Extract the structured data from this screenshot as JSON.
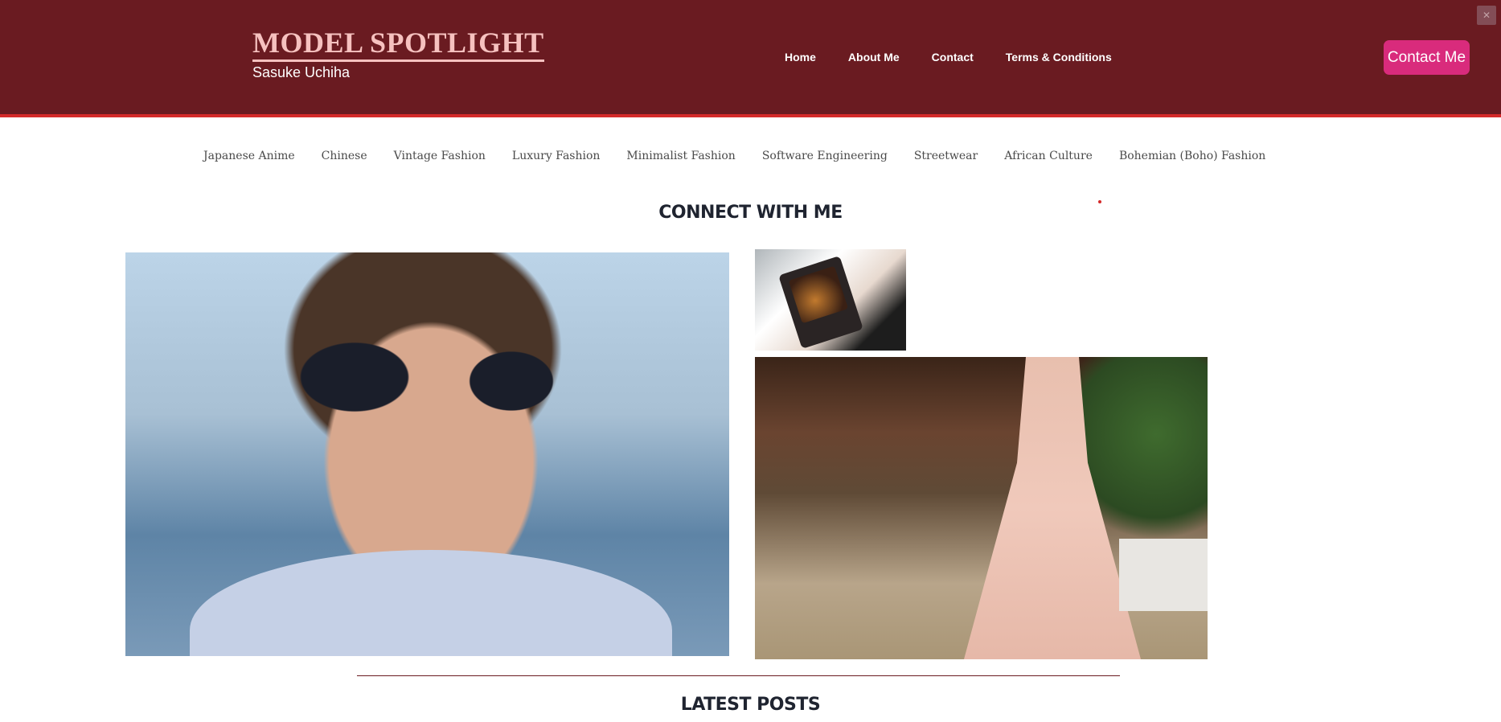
{
  "header": {
    "title": "MODEL SPOTLIGHT",
    "subtitle": "Sasuke Uchiha",
    "nav": [
      "Home",
      "About Me",
      "Contact",
      "Terms & Conditions"
    ],
    "cta_label": "Contact Me"
  },
  "categories": [
    "Japanese Anime",
    "Chinese",
    "Vintage Fashion",
    "Luxury Fashion",
    "Minimalist Fashion",
    "Software Engineering",
    "Streetwear",
    "African Culture",
    "Bohemian (Boho) Fashion"
  ],
  "sections": {
    "connect_title": "CONNECT WITH ME",
    "latest_title": "LATEST POSTS"
  },
  "colors": {
    "header_bg": "#6a1b21",
    "accent_red": "#d42a2a",
    "title_pink": "#f6c1bf",
    "cta_pink": "#d92b7c"
  },
  "icons": {
    "corner": "puzzle-icon"
  }
}
